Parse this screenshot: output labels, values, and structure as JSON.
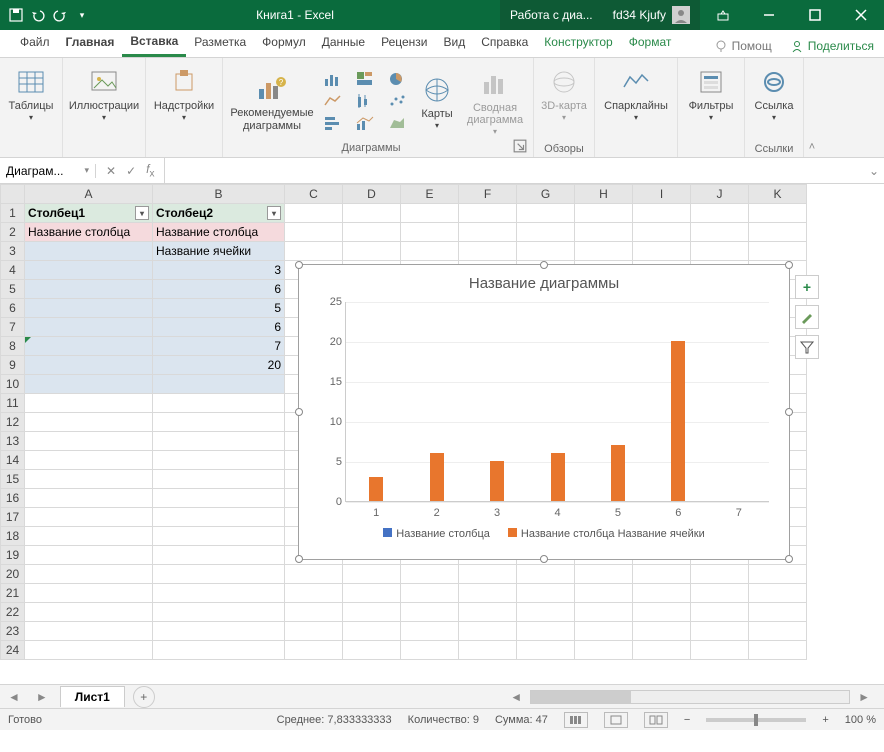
{
  "titlebar": {
    "doc_title": "Книга1 - Excel",
    "context_tab": "Работа с диа...",
    "user_name": "fd34 Kjufy"
  },
  "tabs": {
    "file": "Файл",
    "home": "Главная",
    "insert": "Вставка",
    "layout": "Разметка",
    "formulas": "Формул",
    "data": "Данные",
    "review": "Рецензи",
    "view": "Вид",
    "help": "Справка",
    "design": "Конструктор",
    "format": "Формат",
    "tell_me": "Помощ",
    "share": "Поделиться"
  },
  "ribbon": {
    "tables": "Таблицы",
    "illustrations": "Иллюстрации",
    "addins": "Надстройки",
    "recommended": "Рекомендуемые диаграммы",
    "maps": "Карты",
    "pivotchart": "Сводная диаграмма",
    "map3d": "3D-карта",
    "sparklines": "Спарклайны",
    "filters": "Фильтры",
    "link": "Ссылка",
    "group_charts": "Диаграммы",
    "group_tours": "Обзоры",
    "group_links": "Ссылки"
  },
  "namebox": "Диаграм...",
  "columns": [
    "A",
    "B",
    "C",
    "D",
    "E",
    "F",
    "G",
    "H",
    "I",
    "J",
    "K"
  ],
  "rows": [
    1,
    2,
    3,
    4,
    5,
    6,
    7,
    8,
    9,
    10,
    11,
    12,
    13,
    14,
    15,
    16,
    17,
    18,
    19,
    20,
    21,
    22,
    23,
    24
  ],
  "table": {
    "header_a": "Столбец1",
    "header_b": "Столбец2",
    "r2a": "Название столбца",
    "r2b": "Название столбца",
    "r3b": "Название ячейки",
    "values": [
      3,
      6,
      5,
      6,
      7,
      20
    ]
  },
  "chart_data": {
    "type": "bar",
    "title": "Название диаграммы",
    "categories": [
      1,
      2,
      3,
      4,
      5,
      6,
      7
    ],
    "series": [
      {
        "name": "Название столбца",
        "color": "#4472c4",
        "values": [
          null,
          null,
          null,
          null,
          null,
          null,
          null
        ]
      },
      {
        "name": "Название столбца Название ячейки",
        "color": "#e8762d",
        "values": [
          3,
          6,
          5,
          6,
          7,
          20,
          null
        ]
      }
    ],
    "yticks": [
      0,
      5,
      10,
      15,
      20,
      25
    ],
    "ylim": [
      0,
      25
    ]
  },
  "sheet": {
    "name": "Лист1"
  },
  "status": {
    "ready": "Готово",
    "avg_label": "Среднее:",
    "avg_value": "7,833333333",
    "count_label": "Количество:",
    "count_value": "9",
    "sum_label": "Сумма:",
    "sum_value": "47",
    "zoom": "100 %"
  }
}
